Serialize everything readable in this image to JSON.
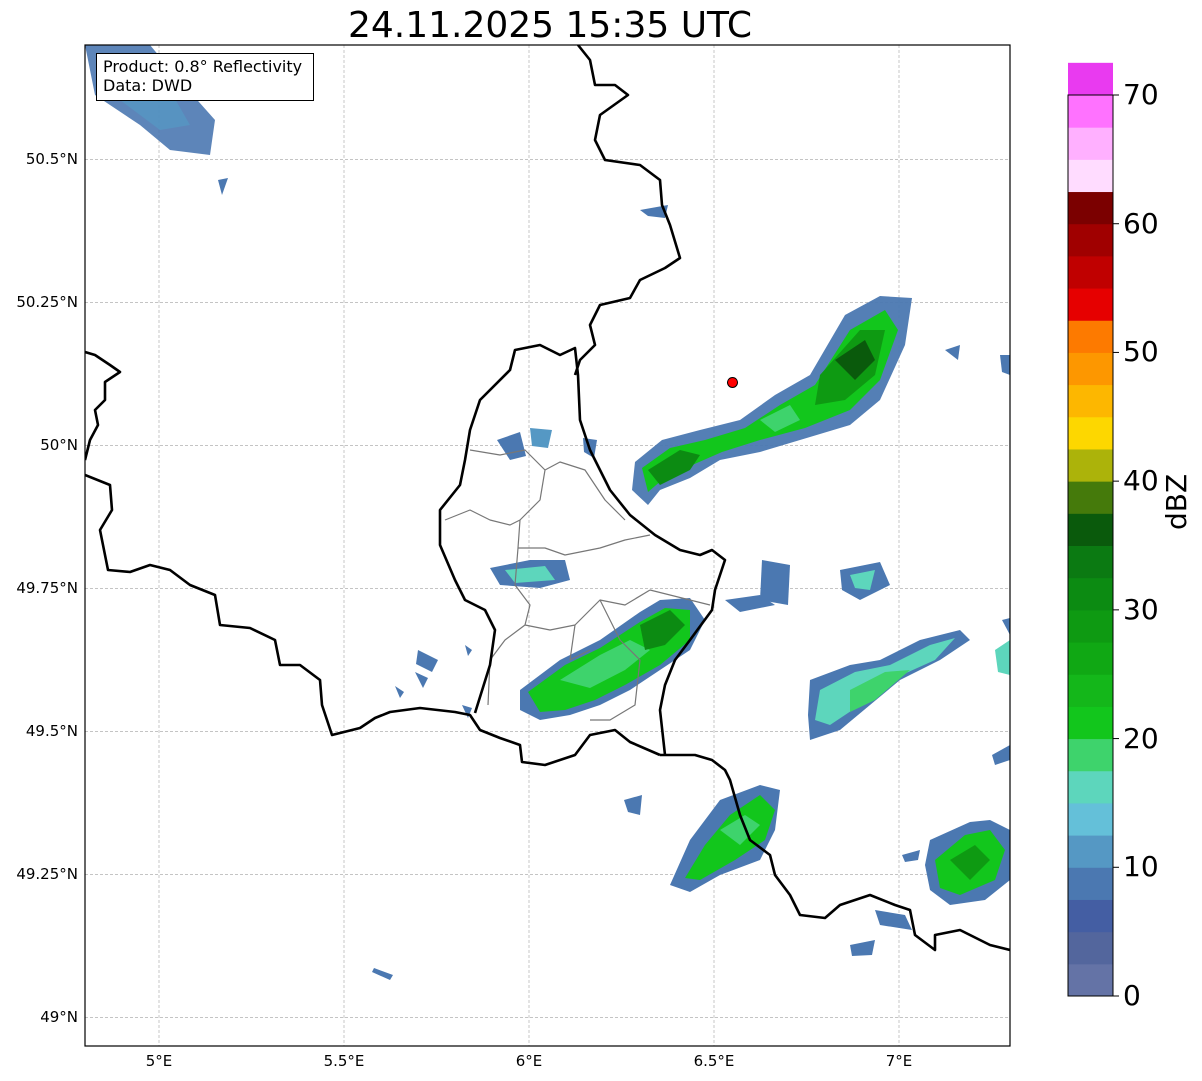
{
  "title": "24.11.2025 15:35 UTC",
  "info": {
    "product": "Product: 0.8° Reflectivity",
    "data": "Data: DWD"
  },
  "map": {
    "lon_range": [
      4.8,
      7.3
    ],
    "lat_range": [
      48.95,
      50.7
    ],
    "lat_ticks": [
      "49°N",
      "49.25°N",
      "49.5°N",
      "49.75°N",
      "50°N",
      "50.25°N",
      "50.5°N"
    ],
    "lon_ticks": [
      "5°E",
      "5.5°E",
      "6°E",
      "6.5°E",
      "7°E"
    ],
    "grid": true,
    "marker": {
      "lon": 6.55,
      "lat": 50.11,
      "color": "#ff0000"
    }
  },
  "colorbar": {
    "label": "dBZ",
    "tick_labels": [
      "0",
      "10",
      "20",
      "30",
      "40",
      "50",
      "60",
      "70"
    ],
    "min": 0,
    "max": 70,
    "step": 2.5,
    "colors": [
      "#6473a6",
      "#53669d",
      "#445ea3",
      "#4b78b1",
      "#5598c4",
      "#64c0d9",
      "#5dd6bc",
      "#3ed36c",
      "#12c61c",
      "#14b71a",
      "#10a814",
      "#0e9a12",
      "#0c8b12",
      "#0b7a12",
      "#0a5a0c",
      "#457a0b",
      "#acb30a",
      "#fdd700",
      "#fdb700",
      "#fd9700",
      "#fd7a00",
      "#e60000",
      "#c00000",
      "#a00000",
      "#7b0000",
      "#ffdcff",
      "#ffb0ff",
      "#ff72ff",
      "#e93af0"
    ]
  }
}
